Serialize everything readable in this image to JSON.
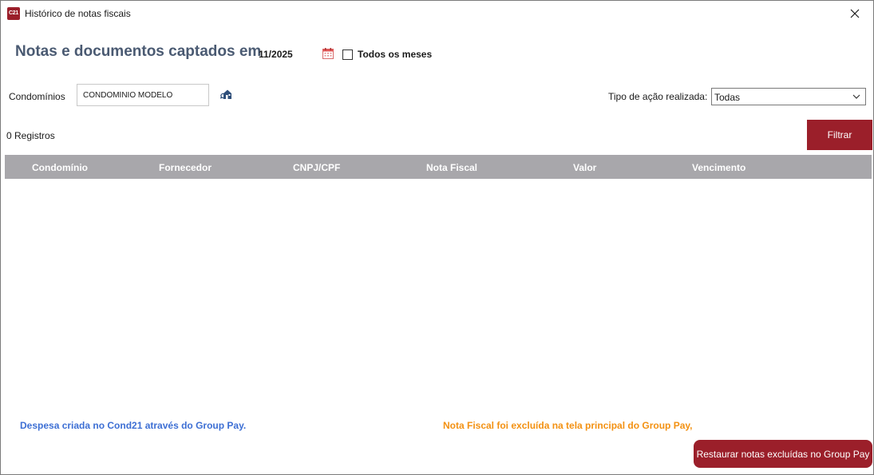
{
  "window": {
    "title": "Histórico de notas fiscais",
    "app_icon_text": "C21"
  },
  "header": {
    "heading": "Notas e documentos captados em",
    "period": "11/2025",
    "all_months_label": "Todos os meses",
    "all_months_checked": false
  },
  "filters": {
    "condominio_label": "Condomínios",
    "condominio_value": "CONDOMÍNIO MODELO",
    "acao_label": "Tipo de ação realizada:",
    "acao_value": "Todas"
  },
  "results": {
    "count_text": "0 Registros",
    "filter_button": "Filtrar"
  },
  "grid": {
    "columns": [
      "Condomínio",
      "Fornecedor",
      "CNPJ/CPF",
      "Nota Fiscal",
      "Valor",
      "Vencimento"
    ],
    "rows": []
  },
  "legend": {
    "blue_text": "Despesa criada no Cond21 através do Group Pay.",
    "orange_text": "Nota Fiscal foi excluída na tela principal do Group Pay,"
  },
  "footer": {
    "restore_button": "Restaurar notas excluídas no Group Pay"
  },
  "colors": {
    "brand": "#9b1f2a",
    "heading": "#4a5a72",
    "grid_header": "#a8a7ab",
    "legend_blue": "#3d6fd4",
    "legend_orange": "#f39112"
  },
  "icons": {
    "calendar": "calendar-icon",
    "building": "building-search-icon",
    "close": "close-icon",
    "dropdown": "chevron-down-icon"
  }
}
